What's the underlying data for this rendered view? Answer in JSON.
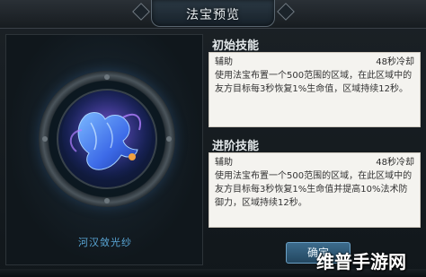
{
  "header": {
    "title": "法宝预览"
  },
  "item": {
    "name": "河汉敛光纱"
  },
  "skills": [
    {
      "section_title": "初始技能",
      "type": "辅助",
      "cooldown": "48秒冷却",
      "description": "使用法宝布置一个500范围的区域，在此区域中的友方目标每3秒恢复1%生命值，区域持续12秒。"
    },
    {
      "section_title": "进阶技能",
      "type": "辅助",
      "cooldown": "48秒冷却",
      "description": "使用法宝布置一个500范围的区域，在此区域中的友方目标每3秒恢复1%生命值并提高10%法术防御力，区域持续12秒。"
    }
  ],
  "button": {
    "confirm": "确定"
  },
  "watermark": {
    "text": "维普手游网"
  },
  "colors": {
    "accent": "#5aa8d8",
    "skill_bg": "#f4f3ef",
    "creature": "#3d6be8"
  }
}
